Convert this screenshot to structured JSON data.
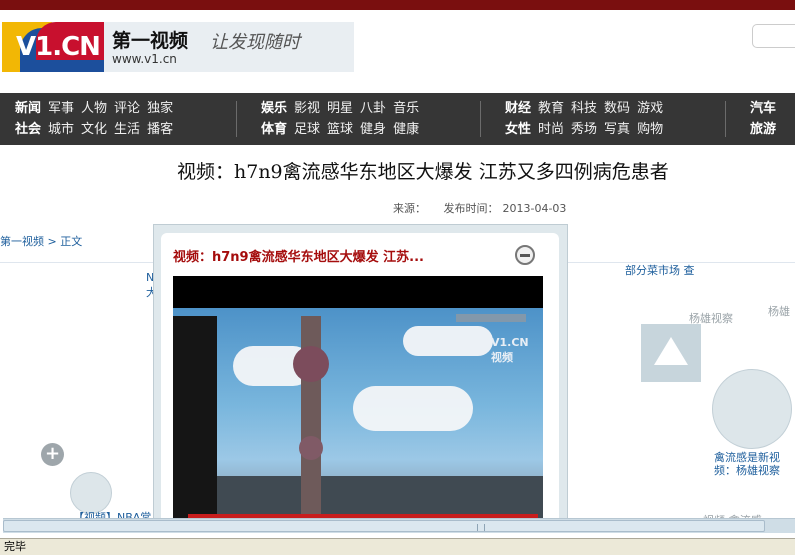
{
  "logo": {
    "mark": "V1.CN",
    "name": "第一视频",
    "url": "www.v1.cn",
    "slogan": "让发现随时"
  },
  "nav": {
    "group1": {
      "row1": [
        "新闻",
        "军事",
        "人物",
        "评论",
        "独家"
      ],
      "row2": [
        "社会",
        "城市",
        "文化",
        "生活",
        "播客"
      ]
    },
    "group2": {
      "row1": [
        "娱乐",
        "影视",
        "明星",
        "八卦",
        "音乐"
      ],
      "row2": [
        "体育",
        "足球",
        "篮球",
        "健身",
        "健康"
      ]
    },
    "group3": {
      "row1": [
        "财经",
        "教育",
        "科技",
        "数码",
        "游戏"
      ],
      "row2": [
        "女性",
        "时尚",
        "秀场",
        "写真",
        "购物"
      ]
    },
    "group4": {
      "row1": [
        "汽车"
      ],
      "row2": [
        "旅游"
      ]
    }
  },
  "article": {
    "headline": "视频：h7n9禽流感华东地区大爆发 江苏又多四例病危患者",
    "source_label": "来源：",
    "date_label": "发布时间：",
    "date": "2013-04-03"
  },
  "breadcrumb": {
    "home": "第一视频",
    "separator": ">",
    "current": "正文"
  },
  "sidebar": {
    "left_top_a": "N",
    "left_top_b": "大",
    "left_bottom": "【视频】NBA常",
    "right_top": "部分菜市场 查",
    "right_yang1": "杨雄视察",
    "right_yang2": "杨雄",
    "right_caption_1": "禽流感是新视",
    "right_caption_2": "频：杨雄视察",
    "right_bottom": "视频:禽流感"
  },
  "popup": {
    "title": "视频：h7n9禽流感华东地区大爆发 江苏...",
    "video_watermark": "V1.CN 视频"
  },
  "statusbar": {
    "text": "完毕"
  }
}
